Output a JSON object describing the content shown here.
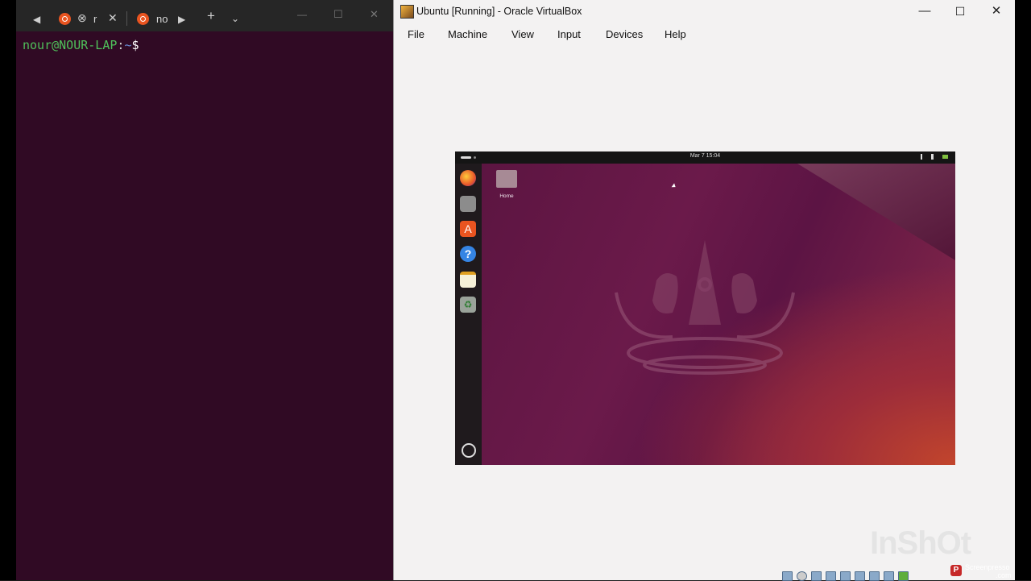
{
  "terminal": {
    "tab1_label": "r",
    "tab2_label": "no",
    "prompt_user": "nour@NOUR-LAP",
    "prompt_sep": ":",
    "prompt_path": "~",
    "prompt_symbol": "$"
  },
  "vbox": {
    "title": "Ubuntu [Running] - Oracle VirtualBox",
    "menu": [
      "File",
      "Machine",
      "View",
      "Input",
      "Devices",
      "Help"
    ]
  },
  "vm": {
    "clock": "Mar 7  15:04",
    "home_label": "Home"
  },
  "watermark": {
    "text": "InShOt",
    "brand": "Screenpresso",
    "brand_sub": ".com"
  },
  "colors": {
    "terminal_bg": "#300a24",
    "prompt_user": "#4fc05a",
    "ubuntu_orange": "#e95420",
    "vbox_bg": "#f3f2f2"
  }
}
